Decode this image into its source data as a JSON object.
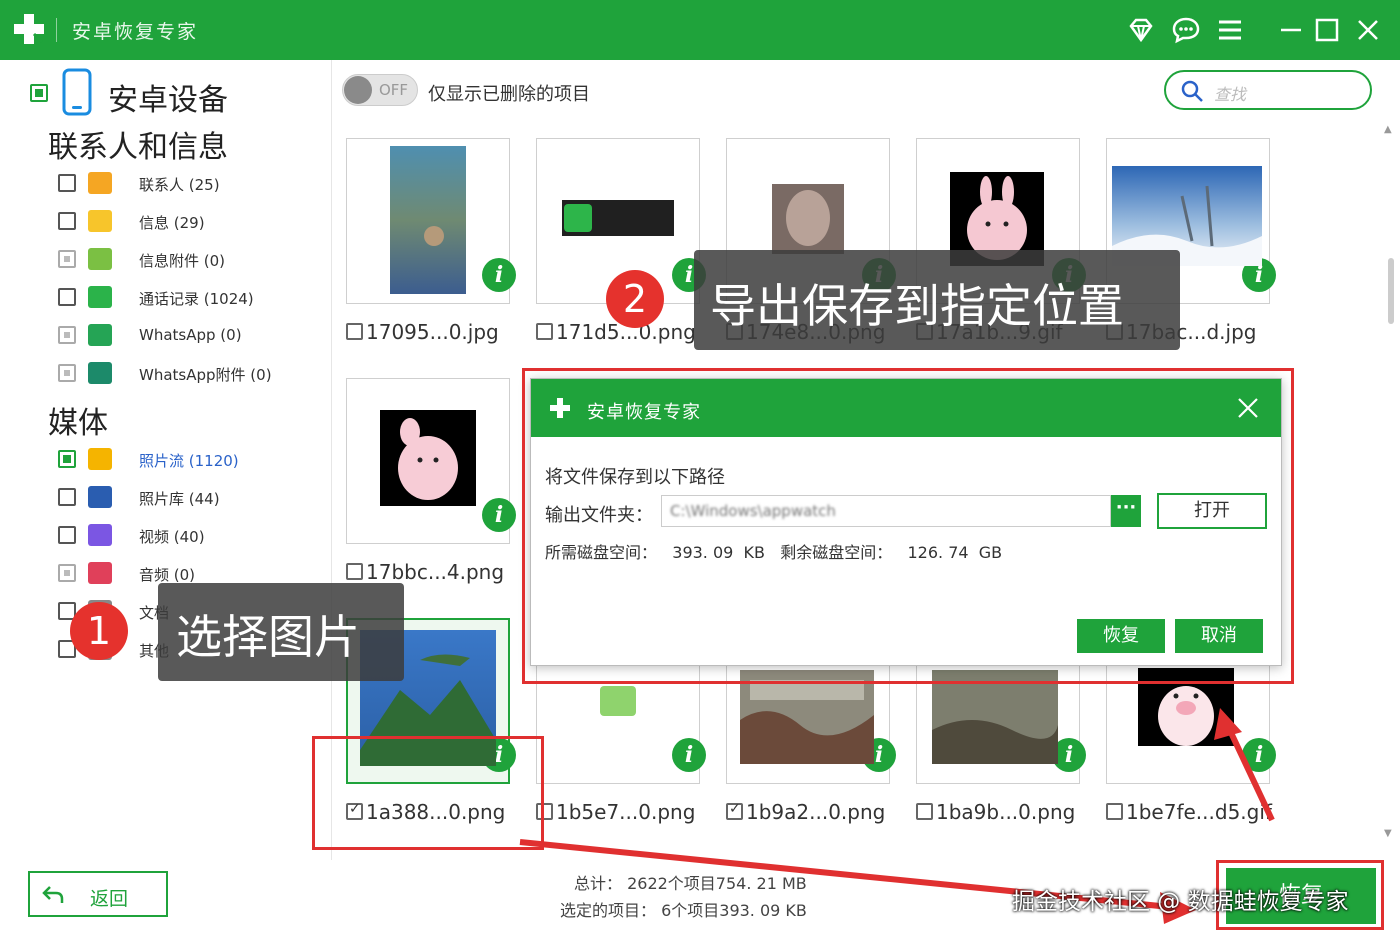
{
  "app": {
    "title": "安卓恢复专家"
  },
  "sidebar": {
    "device_label": "安卓设备",
    "sections": {
      "contacts_info": "联系人和信息",
      "media": "媒体"
    },
    "categories": [
      {
        "label": "联系人 (25)",
        "icon": "contacts-icon",
        "color": "#f5a623",
        "state": "empty"
      },
      {
        "label": "信息 (29)",
        "icon": "messages-icon",
        "color": "#f7c52b",
        "state": "empty"
      },
      {
        "label": "信息附件 (0)",
        "icon": "attachment-icon",
        "color": "#7bc043",
        "state": "grey"
      },
      {
        "label": "通话记录 (1024)",
        "icon": "phone-icon",
        "color": "#2bb34a",
        "state": "empty"
      },
      {
        "label": "WhatsApp (0)",
        "icon": "whatsapp-icon",
        "color": "#25a455",
        "state": "grey"
      },
      {
        "label": "WhatsApp附件 (0)",
        "icon": "whatsapp-attachment-icon",
        "color": "#1c8a6a",
        "state": "grey"
      },
      {
        "label": "照片流 (1120)",
        "icon": "photo-stream-icon",
        "color": "#f5b400",
        "state": "green",
        "active": true
      },
      {
        "label": "照片库 (44)",
        "icon": "photo-library-icon",
        "color": "#2a5db0",
        "state": "empty"
      },
      {
        "label": "视频 (40)",
        "icon": "video-icon",
        "color": "#7b56e3",
        "state": "empty"
      },
      {
        "label": "音频 (0)",
        "icon": "audio-icon",
        "color": "#e0405a",
        "state": "grey"
      },
      {
        "label": "文档",
        "icon": "document-icon",
        "color": "#888888",
        "state": "empty"
      },
      {
        "label": "其他",
        "icon": "other-icon",
        "color": "#888888",
        "state": "empty"
      }
    ]
  },
  "toolbar": {
    "toggle_state": "OFF",
    "only_deleted_label": "仅显示已删除的项目",
    "search_placeholder": "查找"
  },
  "grid": {
    "files": [
      {
        "name": "17095...0.jpg",
        "checked": false
      },
      {
        "name": "171d5...0.png",
        "checked": false
      },
      {
        "name": "174e8...0.png",
        "checked": false
      },
      {
        "name": "17a1b...9.gif",
        "checked": false
      },
      {
        "name": "17bac...d.jpg",
        "checked": false
      },
      {
        "name": "17bbc...4.png",
        "checked": false
      },
      {
        "name": "1a388...0.png",
        "checked": true
      },
      {
        "name": "1b5e7...0.png",
        "checked": false
      },
      {
        "name": "1b9a2...0.png",
        "checked": true
      },
      {
        "name": "1ba9b...0.png",
        "checked": false
      },
      {
        "name": "1be7fe...d5.gif",
        "checked": false
      }
    ]
  },
  "dialog": {
    "title": "安卓恢复专家",
    "save_path_label": "将文件保存到以下路径",
    "output_folder_label": "输出文件夹：",
    "output_folder_value": "C:\\Windows\\appwatch",
    "browse_label": "···",
    "open_label": "打开",
    "disk_info": "所需磁盘空间：   393. 09  KB   剩余磁盘空间：   126. 74  GB",
    "recover_label": "恢复",
    "cancel_label": "取消"
  },
  "annotations": {
    "step1_number": "1",
    "step1_text": "选择图片",
    "step2_number": "2",
    "step2_text": "导出保存到指定位置"
  },
  "footer": {
    "back_label": "返回",
    "total_line": "总计：  2622个项目754. 21  MB",
    "selected_line": "选定的项目：  6个项目393. 09  KB",
    "recover_label": "恢复",
    "watermark": "掘金技术社区 @ 数据蛙恢复专家"
  },
  "colors": {
    "brand": "#1fa33b",
    "annotation": "#e03030"
  }
}
